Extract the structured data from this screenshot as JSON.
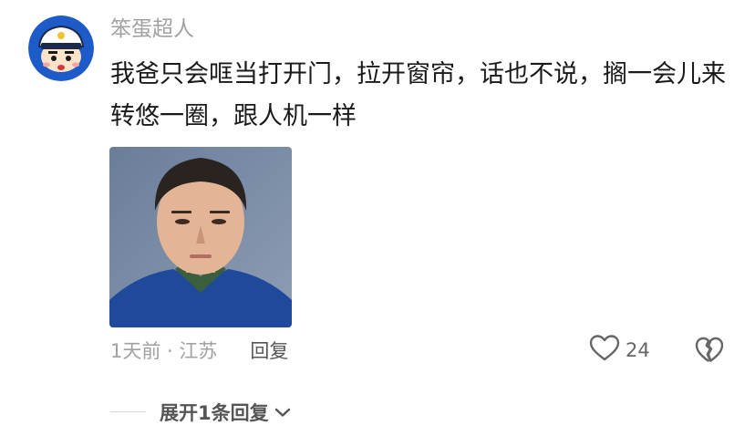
{
  "comment": {
    "username": "笨蛋超人",
    "text": "我爸只会哐当打开门，拉开窗帘，话也不说，搁一会儿来转悠一圈，跟人机一样",
    "time_location": "1天前 · 江苏",
    "reply_label": "回复",
    "like_count": "24",
    "expand_label": "展开1条回复",
    "icons": {
      "avatar": "crayon-shin-chan-police-cap-avatar",
      "like": "heart-outline-icon",
      "dislike": "broken-heart-icon",
      "expand": "chevron-down-icon"
    }
  },
  "colors": {
    "username": "#a1a1a1",
    "text": "#1a1a1a",
    "meta": "#a1a1a1",
    "action": "#555555",
    "avatar_bg": "#1d5bc9"
  }
}
